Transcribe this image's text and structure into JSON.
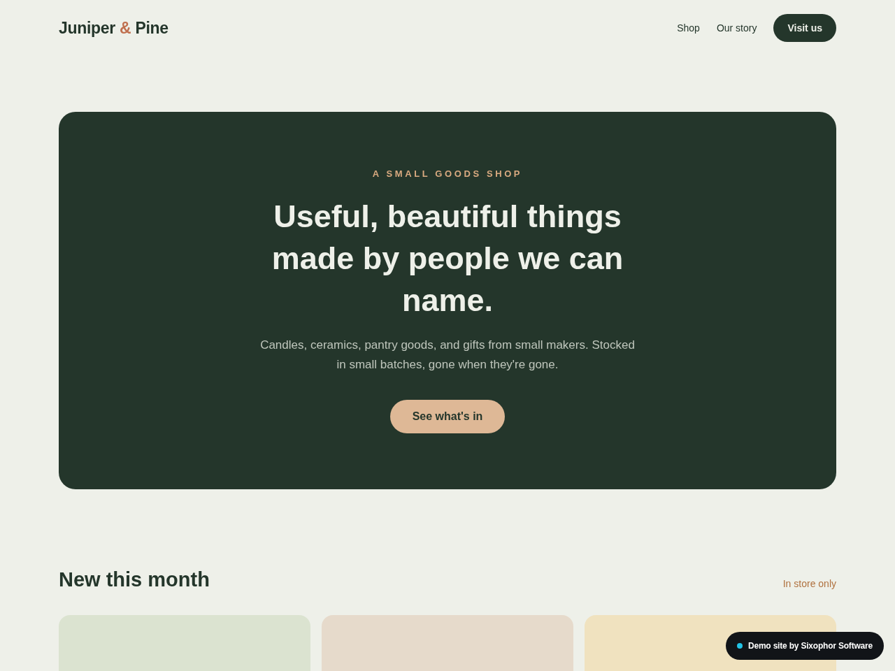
{
  "header": {
    "logo": {
      "name_start": "Juniper",
      "ampersand": "&",
      "name_end": "Pine"
    },
    "nav": [
      "Shop",
      "Our story"
    ],
    "cta": "Visit us"
  },
  "hero": {
    "eyebrow": "A SMALL GOODS SHOP",
    "title": "Useful, beautiful things made by people we can name.",
    "description": "Candles, ceramics, pantry goods, and gifts from small makers. Stocked in small batches, gone when they're gone.",
    "button": "See what's in"
  },
  "new_section": {
    "title": "New this month",
    "note": "In store only",
    "products": [
      {
        "color": "#dbe3d0"
      },
      {
        "color": "#e6dacb"
      },
      {
        "color": "#f0e2bf"
      }
    ]
  },
  "demo_badge": {
    "text": "Demo site by Sixophor Software"
  }
}
